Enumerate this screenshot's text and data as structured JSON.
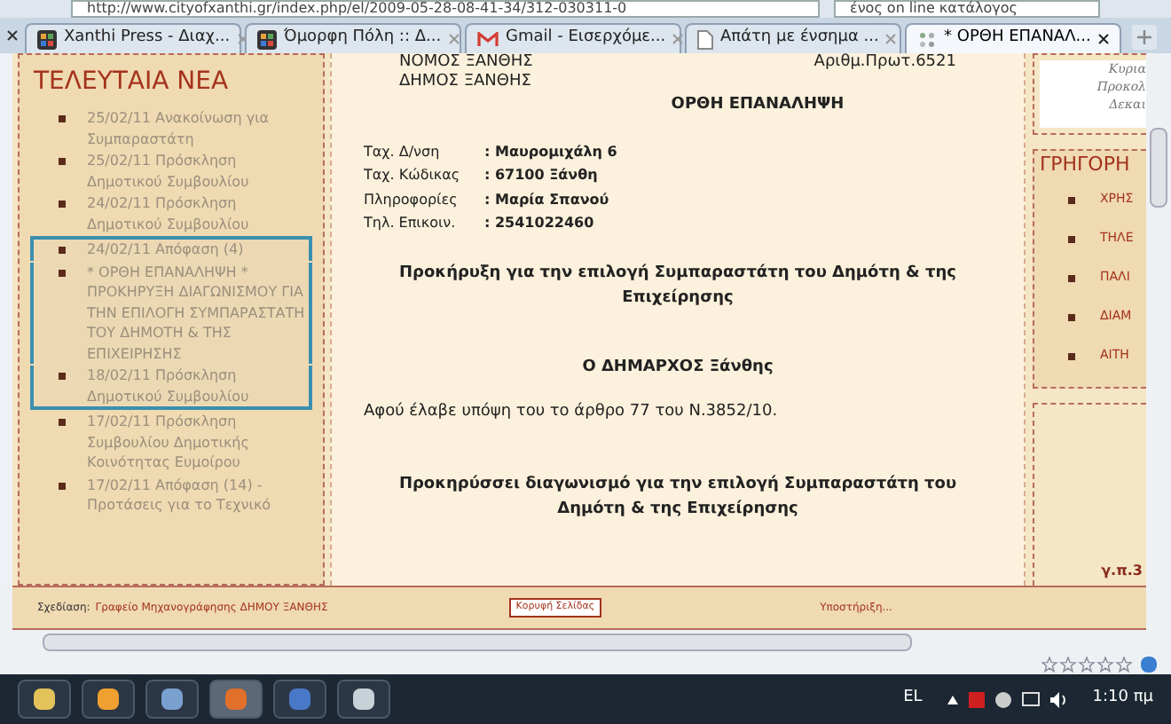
{
  "address_bar": {
    "url": "http://www.cityofxanthi.gr/index.php/el/2009-05-28-08-41-34/312-030311-0",
    "search": "ένος on line κατάλογος"
  },
  "tabs": [
    {
      "label": "Xanthi Press - Διαχ...",
      "selected": false,
      "kind": "site"
    },
    {
      "label": "Όμορφη Πόλη :: Δ...",
      "selected": false,
      "kind": "site"
    },
    {
      "label": "Gmail - Εισερχόμε...",
      "selected": false,
      "kind": "mail"
    },
    {
      "label": "Απάτη με ένσημα ...",
      "selected": false,
      "kind": "page"
    },
    {
      "label": "* ΟΡΘΗ ΕΠΑΝΑΛ...",
      "selected": true,
      "kind": "loading"
    }
  ],
  "latest_news": {
    "title": "ΤΕΛΕΥΤΑΙΑ ΝΕΑ",
    "items": [
      {
        "text": "25/02/11 Ανακοίνωση για Συμπαραστάτη",
        "selected": false
      },
      {
        "text": "25/02/11 Πρόσκληση Δημοτικού Συμβουλίου",
        "selected": false
      },
      {
        "text": "24/02/11 Πρόσκληση Δημοτικού Συμβουλίου",
        "selected": false
      },
      {
        "text": "24/02/11 Απόφαση (4)",
        "selected": true
      },
      {
        "text": "* ΟΡΘΗ ΕΠΑΝΑΛΗΨΗ * ΠΡΟΚΗΡΥΞΗ ΔΙΑΓΩΝΙΣΜΟΥ ΓΙΑ ΤΗΝ ΕΠΙΛΟΓΗ ΣΥΜΠΑΡΑΣΤΑΤΗ ΤΟΥ ΔΗΜΟΤΗ & ΤΗΣ ΕΠΙΧΕΙΡΗΣΗΣ",
        "selected": true
      },
      {
        "text": "18/02/11 Πρόσκληση Δημοτικού Συμβουλίου",
        "selected": true
      },
      {
        "text": "17/02/11 Πρόσκληση Συμβουλίου Δημοτικής Κοινότητας Ευμοίρου",
        "selected": false
      },
      {
        "text": "17/02/11 Απόφαση (14) - Προτάσεις για το Τεχνικό",
        "selected": false
      }
    ]
  },
  "document": {
    "header_left": [
      "ΝΟΜΟΣ ΞΑΝΘΗΣ",
      "ΔΗΜΟΣ ΞΑΝΘΗΣ"
    ],
    "protocol": "Αριθμ.Πρωτ.6521",
    "title": "ΟΡΘΗ ΕΠΑΝΑΛΗΨΗ",
    "details": [
      {
        "label": "Ταχ. Δ/νση",
        "value": ": Μαυρομιχάλη 6"
      },
      {
        "label": "Ταχ. Κώδικας",
        "value": ": 67100 Ξάνθη"
      },
      {
        "label": "Πληροφορίες",
        "value": ": Μαρία Σπανού"
      },
      {
        "label": "Τηλ. Επικοιν.",
        "value": ": 2541022460"
      }
    ],
    "heading": "Προκήρυξη για την επιλογή Συμπαραστάτη του Δημότη & της Επιχείρησης",
    "mayor": "Ο ΔΗΜΑΡΧΟΣ Ξάνθης",
    "paragraph": "Αφού έλαβε υπόψη του το άρθρο 77 του Ν.3852/10.",
    "announcement": "Προκηρύσσει διαγωνισμό για την επιλογή Συμπαραστάτη του Δημότη & της Επιχείρησης"
  },
  "right_panel": {
    "banner_lines": [
      "Κυρια",
      "Προκολ",
      "Δεκαι"
    ],
    "quick_title": "ΓΡΗΓΟΡΗ",
    "quick_links": [
      "ΧΡΗΣ",
      "ΤΗΛΕ",
      "ΠΑΛΙ",
      "ΔΙΑΜ",
      "ΑΙΤΗ"
    ],
    "bottom_label": "γ.π.3"
  },
  "footer": {
    "design_label": "Σχεδίαση:",
    "design_value": "Γραφείο Μηχανογράφησης ΔΗΜΟΥ ΞΑΝΘΗΣ",
    "top_button": "Κορυφή Σελίδας",
    "right_text": "Υποστήριξη..."
  },
  "taskbar": {
    "language": "EL",
    "time": "1:10 πμ"
  }
}
